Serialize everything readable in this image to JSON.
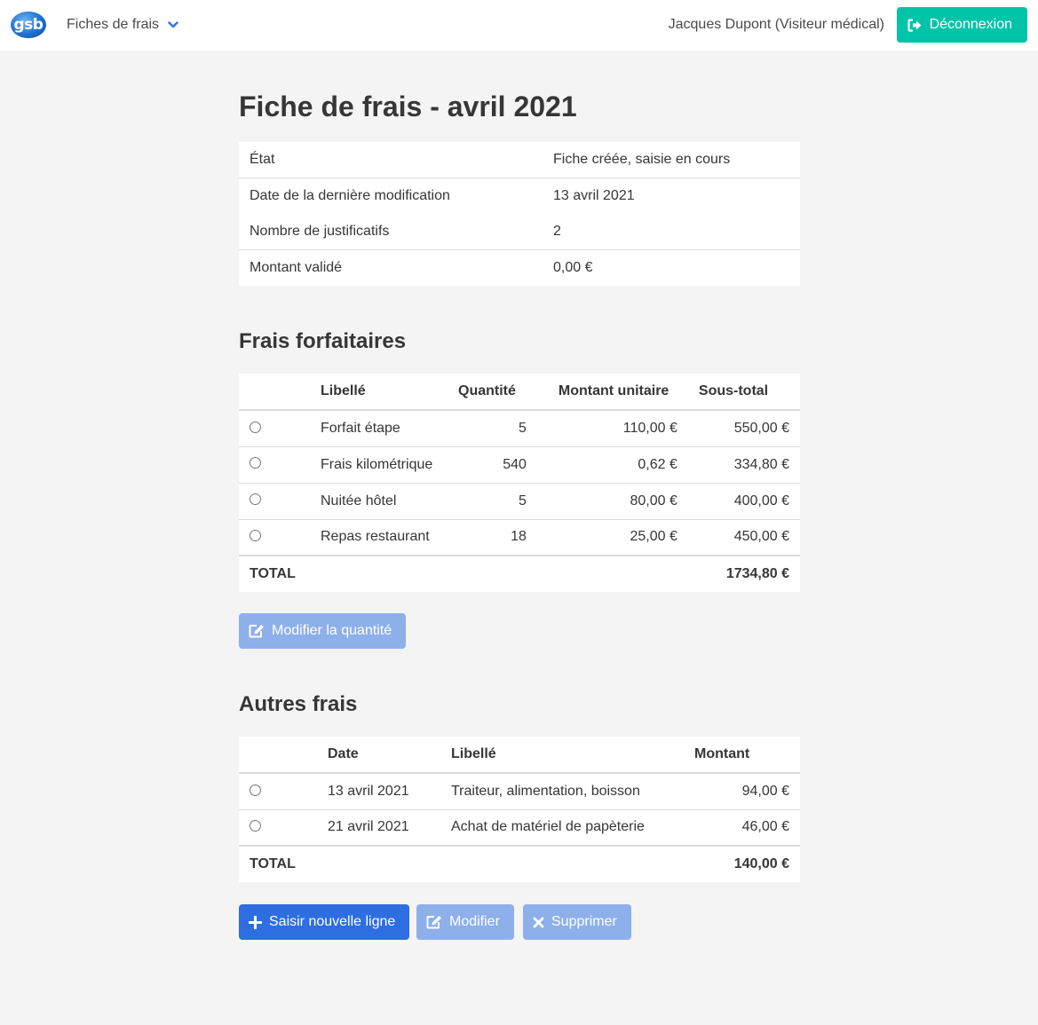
{
  "navbar": {
    "logo_text": "gsb",
    "menu_label": "Fiches de frais",
    "user": "Jacques Dupont (Visiteur médical)",
    "logout_label": "Déconnexion"
  },
  "page": {
    "title": "Fiche de frais - avril 2021"
  },
  "info": {
    "rows": [
      {
        "label": "État",
        "value": "Fiche créée, saisie en cours"
      },
      {
        "label": "Date de la dernière modification",
        "value": "13 avril 2021"
      },
      {
        "label": "Nombre de justificatifs",
        "value": "2"
      },
      {
        "label": "Montant validé",
        "value": "0,00 €"
      }
    ]
  },
  "forfait": {
    "heading": "Frais forfaitaires",
    "columns": [
      "Libellé",
      "Quantité",
      "Montant unitaire",
      "Sous-total"
    ],
    "rows": [
      {
        "libelle": "Forfait étape",
        "quantite": "5",
        "unitaire": "110,00 €",
        "sous_total": "550,00 €"
      },
      {
        "libelle": "Frais kilométrique",
        "quantite": "540",
        "unitaire": "0,62 €",
        "sous_total": "334,80 €"
      },
      {
        "libelle": "Nuitée hôtel",
        "quantite": "5",
        "unitaire": "80,00 €",
        "sous_total": "400,00 €"
      },
      {
        "libelle": "Repas restaurant",
        "quantite": "18",
        "unitaire": "25,00 €",
        "sous_total": "450,00 €"
      }
    ],
    "total_label": "TOTAL",
    "total": "1734,80 €",
    "modify_label": "Modifier la quantité"
  },
  "autres": {
    "heading": "Autres frais",
    "columns": [
      "Date",
      "Libellé",
      "Montant"
    ],
    "rows": [
      {
        "date": "13 avril 2021",
        "libelle": "Traiteur, alimentation, boisson",
        "montant": "94,00 €"
      },
      {
        "date": "21 avril 2021",
        "libelle": "Achat de matériel de papèterie",
        "montant": "46,00 €"
      }
    ],
    "total_label": "TOTAL",
    "total": "140,00 €",
    "add_label": "Saisir nouvelle ligne",
    "edit_label": "Modifier",
    "delete_label": "Supprimer"
  },
  "colors": {
    "success": "#00c4a7",
    "primary": "#2f6ee0",
    "primary_disabled": "#8db0eb",
    "background": "#f4f4f4"
  }
}
